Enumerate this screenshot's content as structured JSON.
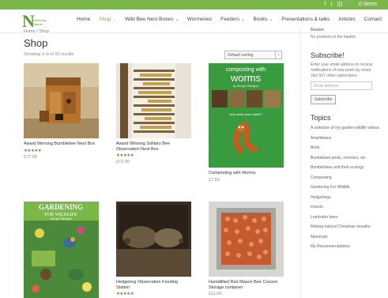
{
  "topbar": {
    "icons": [
      "facebook-icon",
      "twitter-icon",
      "rss-icon"
    ],
    "cart_label": "0 Items"
  },
  "logo": {
    "letter": "N",
    "text": "Nurturing Nature"
  },
  "nav": [
    {
      "label": "Home",
      "caret": false,
      "active": false
    },
    {
      "label": "Shop",
      "caret": true,
      "active": true
    },
    {
      "label": "Wild Bee Nest Boxes",
      "caret": true,
      "active": false
    },
    {
      "label": "Wormeries",
      "caret": false,
      "active": false
    },
    {
      "label": "Feeders",
      "caret": true,
      "active": false
    },
    {
      "label": "Books",
      "caret": true,
      "active": false
    },
    {
      "label": "Presentations & talks",
      "caret": false,
      "active": false
    },
    {
      "label": "Articles",
      "caret": false,
      "active": false
    },
    {
      "label": "Contact",
      "caret": false,
      "active": false
    }
  ],
  "breadcrumb": "Home / Shop",
  "page_title": "Shop",
  "results_count": "Showing 1–9 of 15 results",
  "sort_label": "Default sorting",
  "products": [
    {
      "name": "Award Winning Bumblebee Nest Box",
      "stars": "★★★★★",
      "price": "£77.00"
    },
    {
      "name": "Award Winning Solitary Bee Observation Nest Box",
      "stars": "★★★★★",
      "price": "£72.00"
    },
    {
      "name": "Composting with Worms",
      "stars": "",
      "price": "£7.50"
    },
    {
      "name": "",
      "stars": "",
      "price": ""
    },
    {
      "name": "Hedgehog Observation Feeding Station",
      "stars": "★★★★★",
      "price": ""
    },
    {
      "name": "Humidified Red Mason Bee Cocoon Storage container",
      "stars": "",
      "price": "£11.00"
    }
  ],
  "book_cover_worms": {
    "title_line1": "composting with",
    "title_line2": "worms",
    "author": "by George Pilkington",
    "question": "why waste your waste?"
  },
  "book_cover_garden": {
    "title_line1": "GARDENING",
    "title_line2": "FOR WILDLIFE",
    "author": "George Pilkington"
  },
  "sidebar": {
    "basket_heading": "Basket",
    "basket_empty": "No products in the basket.",
    "subscribe_heading": "Subscribe!",
    "subscribe_text": "Enter your email address to receive notifications of new posts by email.",
    "subscribe_count": "Join 567 other subscribers",
    "email_placeholder": "Email Address",
    "subscribe_button": "Subscribe",
    "topics_heading": "Topics",
    "topics": [
      "A selection of my garden wildlife videos",
      "Amphibians",
      "Birds",
      "Bumblebee pests, enemies, etc.",
      "Bumblebees and their ecology",
      "Composting",
      "Gardening For Wildlife",
      "Hedgehogs",
      "Insects",
      "Leafcutter bees",
      "Making natural Christmas wreaths",
      "Mammals",
      "My Recommendations"
    ]
  },
  "colors": {
    "accent": "#7ab84a",
    "green_dark": "#5a9a3a"
  }
}
